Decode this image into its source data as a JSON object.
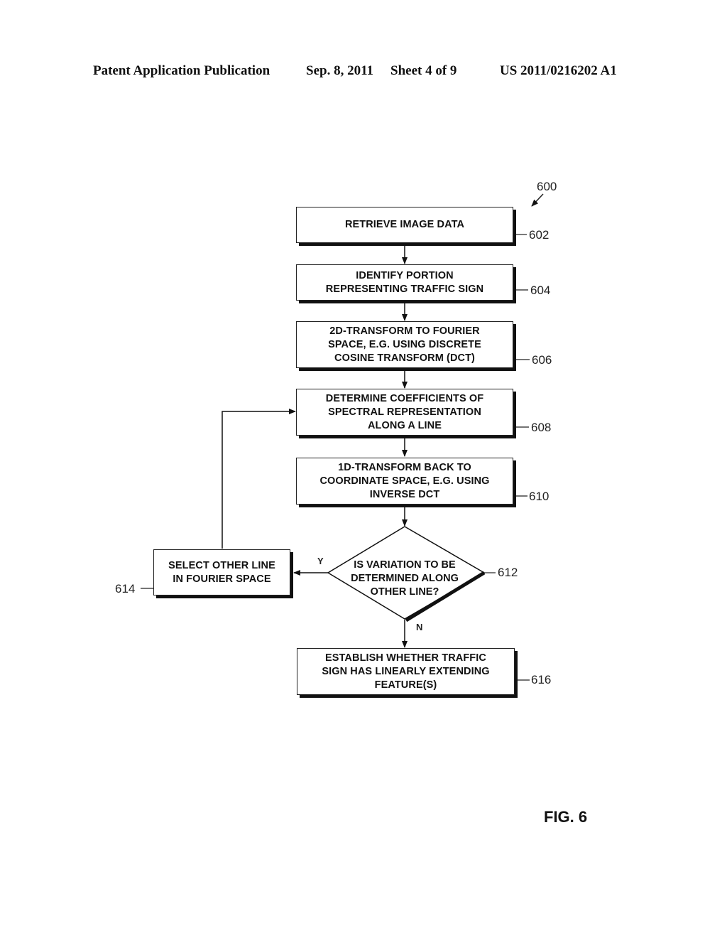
{
  "header": {
    "publication": "Patent Application Publication",
    "date": "Sep. 8, 2011",
    "sheet": "Sheet 4 of 9",
    "number": "US 2011/0216202 A1"
  },
  "figure": {
    "ref": "600",
    "label": "FIG. 6"
  },
  "steps": [
    {
      "ref": "602",
      "text": "RETRIEVE IMAGE DATA"
    },
    {
      "ref": "604",
      "text": "IDENTIFY PORTION\nREPRESENTING TRAFFIC SIGN"
    },
    {
      "ref": "606",
      "text": "2D-TRANSFORM TO FOURIER\nSPACE, E.G. USING DISCRETE\nCOSINE TRANSFORM (DCT)"
    },
    {
      "ref": "608",
      "text": "DETERMINE COEFFICIENTS OF\nSPECTRAL REPRESENTATION\nALONG A LINE"
    },
    {
      "ref": "610",
      "text": "1D-TRANSFORM BACK TO\nCOORDINATE SPACE, E.G. USING\nINVERSE DCT"
    },
    {
      "ref": "612",
      "text": "IS VARIATION TO BE\nDETERMINED ALONG\nOTHER LINE?"
    },
    {
      "ref": "614",
      "text": "SELECT OTHER LINE\nIN FOURIER SPACE"
    },
    {
      "ref": "616",
      "text": "ESTABLISH WHETHER TRAFFIC\nSIGN HAS LINEARLY EXTENDING\nFEATURE(S)"
    }
  ],
  "branches": {
    "yes": "Y",
    "no": "N"
  }
}
